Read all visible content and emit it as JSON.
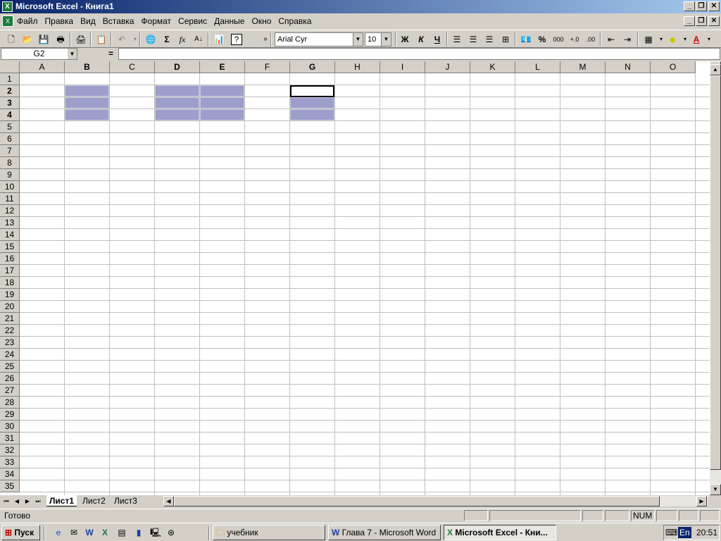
{
  "window": {
    "title": "Microsoft Excel - Книга1"
  },
  "menu": [
    "Файл",
    "Правка",
    "Вид",
    "Вставка",
    "Формат",
    "Сервис",
    "Данные",
    "Окно",
    "Справка"
  ],
  "toolbar": {
    "font_name": "Arial Cyr",
    "font_size": "10",
    "bold_label": "Ж",
    "italic_label": "К",
    "underline_label": "Ч",
    "sum_label": "Σ",
    "fx_label": "fx",
    "percent_label": "%",
    "thousands_label": "000"
  },
  "formula_bar": {
    "name_box": "G2",
    "equals": "=",
    "formula": ""
  },
  "grid": {
    "columns": [
      "A",
      "B",
      "C",
      "D",
      "E",
      "F",
      "G",
      "H",
      "I",
      "J",
      "K",
      "L",
      "M",
      "N",
      "O"
    ],
    "rows": [
      "1",
      "2",
      "3",
      "4",
      "5",
      "6",
      "7",
      "8",
      "9",
      "10",
      "11",
      "12",
      "13",
      "14",
      "15",
      "16",
      "17",
      "18",
      "19",
      "20",
      "21",
      "22",
      "23",
      "24",
      "25",
      "26",
      "27",
      "28",
      "29",
      "30",
      "31",
      "32",
      "33",
      "34",
      "35"
    ],
    "selected_columns": [
      "B",
      "D",
      "E",
      "G"
    ],
    "selected_rows": [
      "2",
      "3",
      "4"
    ],
    "selection_ranges": [
      "B2:B4",
      "D2:E4",
      "G2:G4"
    ],
    "active_cell": "G2",
    "selection_color": "#9e9ecc"
  },
  "sheets": {
    "tabs": [
      "Лист1",
      "Лист2",
      "Лист3"
    ],
    "active": "Лист1"
  },
  "status": {
    "text": "Готово",
    "num": "NUM"
  },
  "taskbar": {
    "start_label": "Пуск",
    "tasks": [
      "учебник",
      "Глава 7 - Microsoft Word",
      "Microsoft Excel - Кни..."
    ],
    "active_task": "Microsoft Excel - Кни...",
    "language": "En",
    "clock": "20:51"
  }
}
